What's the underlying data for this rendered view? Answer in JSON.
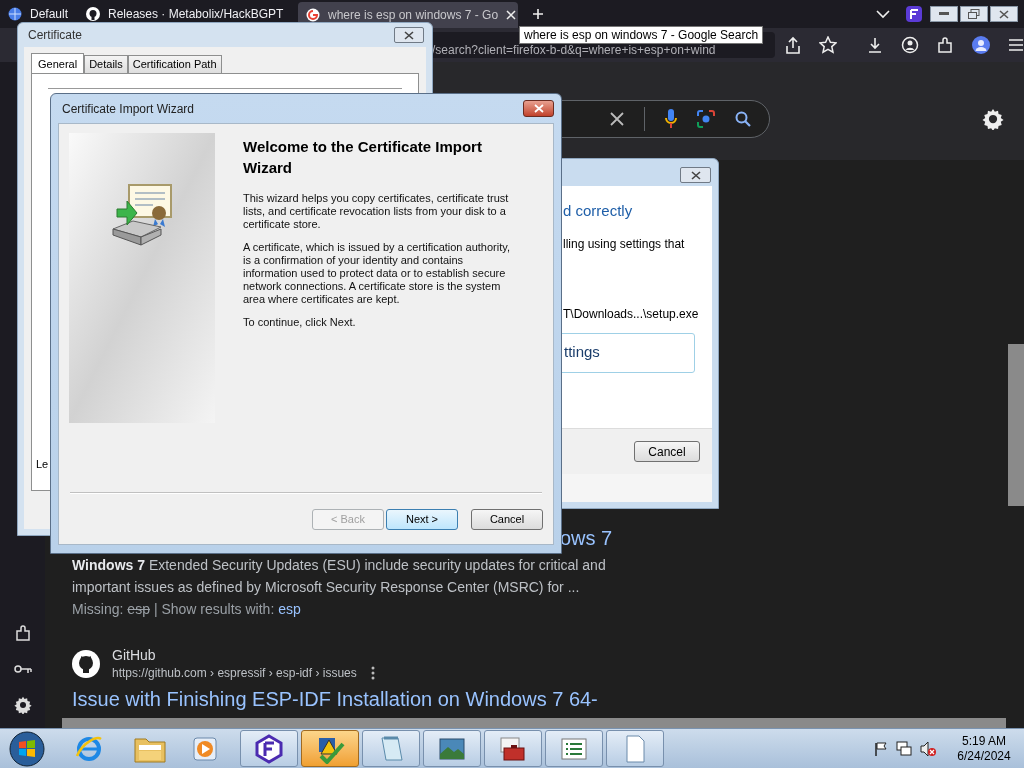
{
  "browser": {
    "tabs": [
      {
        "title": "Default",
        "selected": false
      },
      {
        "title": "Releases · Metabolix/HackBGPT",
        "selected": false
      },
      {
        "title": "where is esp on windows 7 - Go",
        "selected": true
      }
    ],
    "tooltip": "where is esp on windows 7 - Google Search",
    "url": "/search?client=firefox-b-d&q=where+is+esp+on+wind"
  },
  "results": [
    {
      "title": "ows 7",
      "snippet": "**Windows 7** Extended Security Updates (ESU) include security updates for critical and important issues as defined by Microsoft Security Response Center (MSRC) for ...",
      "missing_label": "Missing:",
      "missing_term": "esp",
      "show_label": "| Show results with:",
      "show_term": "esp"
    },
    {
      "site": "GitHub",
      "url": "https://github.com › espressif › esp-idf › issues",
      "title": "Issue with Finishing ESP-IDF Installation on Windows 7 64-"
    }
  ],
  "certificate": {
    "title": "Certificate",
    "tabs": [
      {
        "label": "General",
        "selected": true
      },
      {
        "label": "Details",
        "selected": false
      },
      {
        "label": "Certification Path",
        "selected": false
      }
    ],
    "partial_text": "Le"
  },
  "compat_dialog": {
    "heading": "d correctly",
    "message": "lling using settings that",
    "path": "T\\Downloads...\\setup.exe",
    "option": "ttings",
    "cancel": "Cancel"
  },
  "wizard": {
    "title": "Certificate Import Wizard",
    "heading": "Welcome to the Certificate Import Wizard",
    "paragraphs": [
      "This wizard helps you copy certificates, certificate trust lists, and certificate revocation lists from your disk to a certificate store.",
      "A certificate, which is issued by a certification authority, is a confirmation of your identity and contains information used to protect data or to establish secure network connections. A certificate store is the system area where certificates are kept.",
      "To continue, click Next."
    ],
    "buttons": [
      {
        "label": "< Back",
        "disabled": true,
        "focused": false
      },
      {
        "label": "Next >",
        "disabled": false,
        "focused": true
      },
      {
        "label": "Cancel",
        "disabled": false,
        "focused": false
      }
    ]
  },
  "taskbar": {
    "running": [
      {
        "selected": false
      },
      {
        "selected": true
      },
      {
        "selected": false
      },
      {
        "selected": false
      },
      {
        "selected": false
      },
      {
        "selected": false
      },
      {
        "selected": false
      }
    ],
    "clock": {
      "time": "5:19 AM",
      "date": "6/24/2024"
    }
  }
}
